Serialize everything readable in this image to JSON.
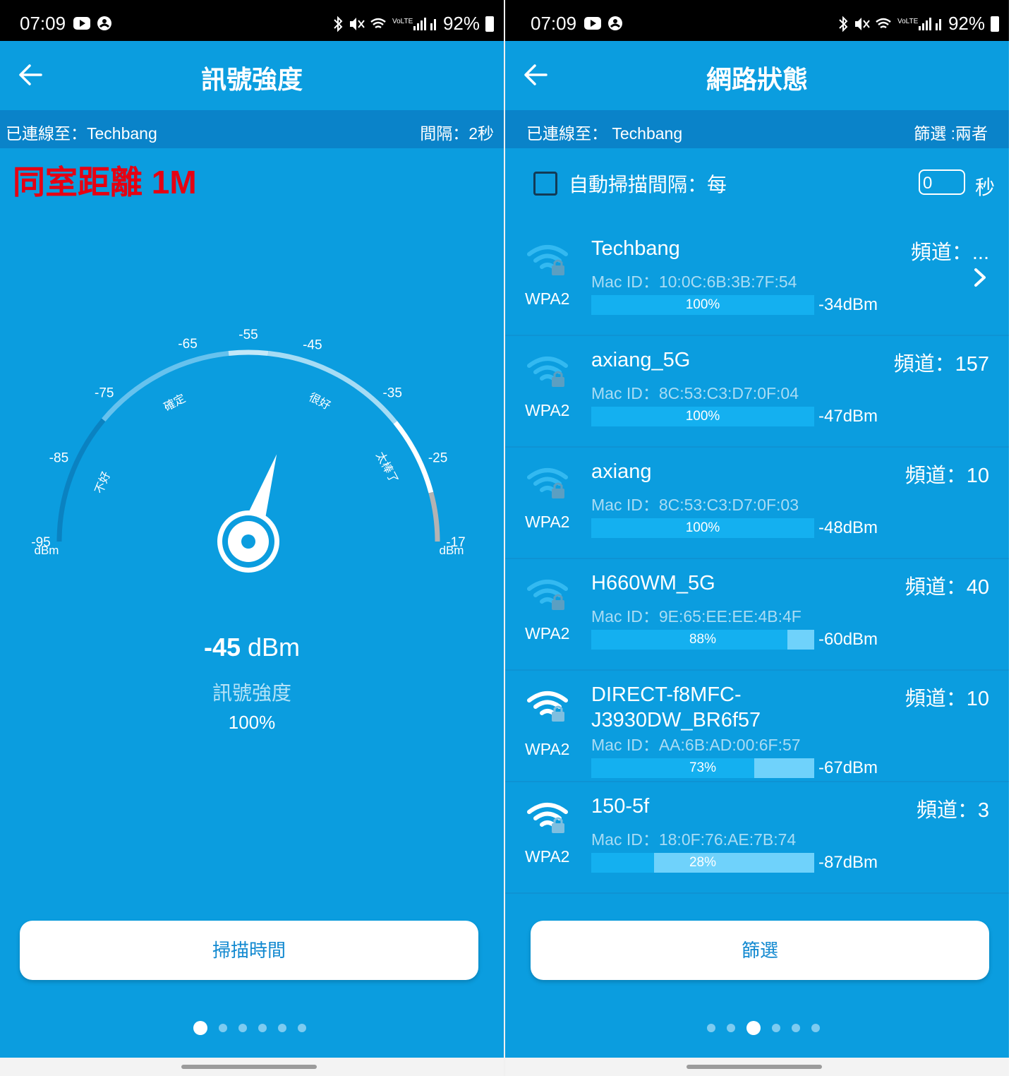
{
  "status_bar": {
    "time": "07:09",
    "battery": "92%"
  },
  "left": {
    "title": "訊號強度",
    "connected": "已連線至：Techbang",
    "interval": "間隔：2秒",
    "overlay_label": "同室距離 1M",
    "gauge": {
      "ticks": [
        "-95",
        "-85",
        "-75",
        "-65",
        "-55",
        "-45",
        "-35",
        "-25",
        "-17"
      ],
      "unit": "dBm",
      "zones": [
        "不好",
        "確定",
        "很好",
        "太棒了"
      ],
      "needle_value": -45
    },
    "reading_value": "-45",
    "reading_unit": " dBm",
    "reading_label": "訊號強度",
    "reading_percent": "100%",
    "button": "掃描時間",
    "active_page": 0
  },
  "right": {
    "title": "網路狀態",
    "connected": "已連線至： Techbang",
    "filter": "篩選 :兩者",
    "autoscan_label": "自動掃描間隔：每",
    "autoscan_value": "0",
    "autoscan_unit": "秒",
    "networks": [
      {
        "ssid": "Techbang",
        "channel": "頻道：...",
        "mac": "Mac ID：10:0C:6B:3B:7F:54",
        "security": "WPA2",
        "percent": "100%",
        "fill": 1.0,
        "dbm": "-34dBm",
        "bright": false,
        "chevron": true
      },
      {
        "ssid": "axiang_5G",
        "channel": "頻道：157",
        "mac": "Mac ID：8C:53:C3:D7:0F:04",
        "security": "WPA2",
        "percent": "100%",
        "fill": 1.0,
        "dbm": "-47dBm",
        "bright": false,
        "chevron": false
      },
      {
        "ssid": "axiang",
        "channel": "頻道：10",
        "mac": "Mac ID：8C:53:C3:D7:0F:03",
        "security": "WPA2",
        "percent": "100%",
        "fill": 1.0,
        "dbm": "-48dBm",
        "bright": false,
        "chevron": false
      },
      {
        "ssid": "H660WM_5G",
        "channel": "頻道：40",
        "mac": "Mac ID：9E:65:EE:EE:4B:4F",
        "security": "WPA2",
        "percent": "88%",
        "fill": 0.88,
        "dbm": "-60dBm",
        "bright": false,
        "chevron": false
      },
      {
        "ssid": "DIRECT-f8MFC-J3930DW_BR6f57",
        "channel": "頻道：10",
        "mac": "Mac ID：AA:6B:AD:00:6F:57",
        "security": "WPA2",
        "percent": "73%",
        "fill": 0.73,
        "dbm": "-67dBm",
        "bright": true,
        "chevron": false
      },
      {
        "ssid": "150-5f",
        "channel": "頻道：3",
        "mac": "Mac ID：18:0F:76:AE:7B:74",
        "security": "WPA2",
        "percent": "28%",
        "fill": 0.28,
        "dbm": "-87dBm",
        "bright": true,
        "chevron": false
      }
    ],
    "button": "篩選",
    "active_page": 2
  },
  "page_count": 6,
  "colors": {
    "background": "#0b9ddf",
    "infobar": "#0a83c9",
    "accent_red": "#e60012",
    "bar_fill": "#14b0f0",
    "bar_empty": "#6fd2fb",
    "button_text": "#1289d0"
  }
}
